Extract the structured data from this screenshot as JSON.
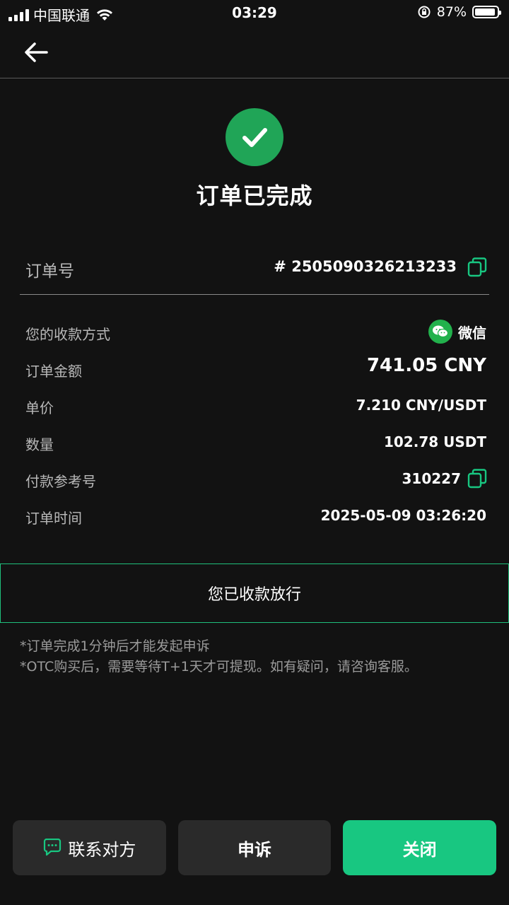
{
  "status_bar": {
    "carrier": "中国联通",
    "time": "03:29",
    "battery": "87%"
  },
  "header": {
    "back_icon": "arrow-left-icon"
  },
  "status": {
    "icon": "check-circle-icon",
    "title": "订单已完成",
    "color": "#20a557"
  },
  "order": {
    "number_label": "订单号",
    "number_value": "# 2505090326213233"
  },
  "details": {
    "payment_method_label": "您的收款方式",
    "payment_method_value": "微信",
    "amount_label": "订单金额",
    "amount_value": "741.05 CNY",
    "price_label": "单价",
    "price_value": "7.210 CNY/USDT",
    "quantity_label": "数量",
    "quantity_value": "102.78 USDT",
    "reference_label": "付款参考号",
    "reference_value": "310227",
    "time_label": "订单时间",
    "time_value": "2025-05-09 03:26:20"
  },
  "release": {
    "label": "您已收款放行"
  },
  "notes": {
    "line1": "*订单完成1分钟后才能发起申诉",
    "line2": "*OTC购买后，需要等待T+1天才可提现。如有疑问，请咨询客服。"
  },
  "actions": {
    "contact_label": "联系对方",
    "appeal_label": "申诉",
    "close_label": "关闭"
  },
  "colors": {
    "accent": "#18c781",
    "background": "#121212"
  }
}
